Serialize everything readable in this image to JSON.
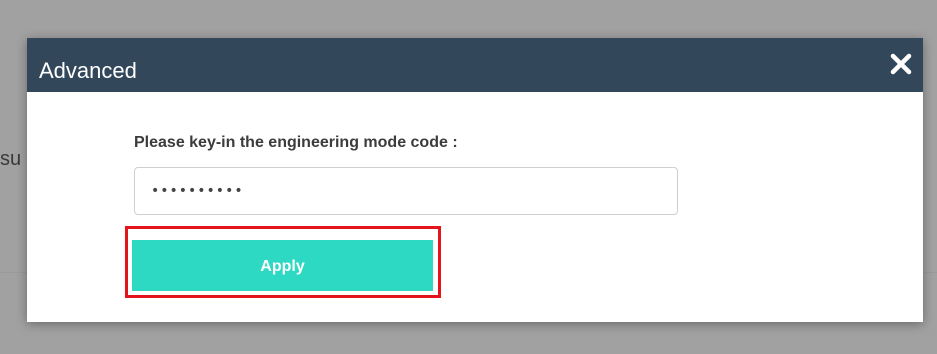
{
  "background": {
    "peek_text": "su"
  },
  "dialog": {
    "title": "Advanced",
    "close_icon": "close-icon",
    "prompt_label": "Please key-in the engineering mode code :",
    "code_input": {
      "value": "••••••••••",
      "type": "password"
    },
    "apply_label": "Apply"
  },
  "colors": {
    "header_bg": "#33475b",
    "apply_bg": "#2ed9c3",
    "highlight_border": "#e4141b",
    "backdrop": "#7c7c7c"
  }
}
